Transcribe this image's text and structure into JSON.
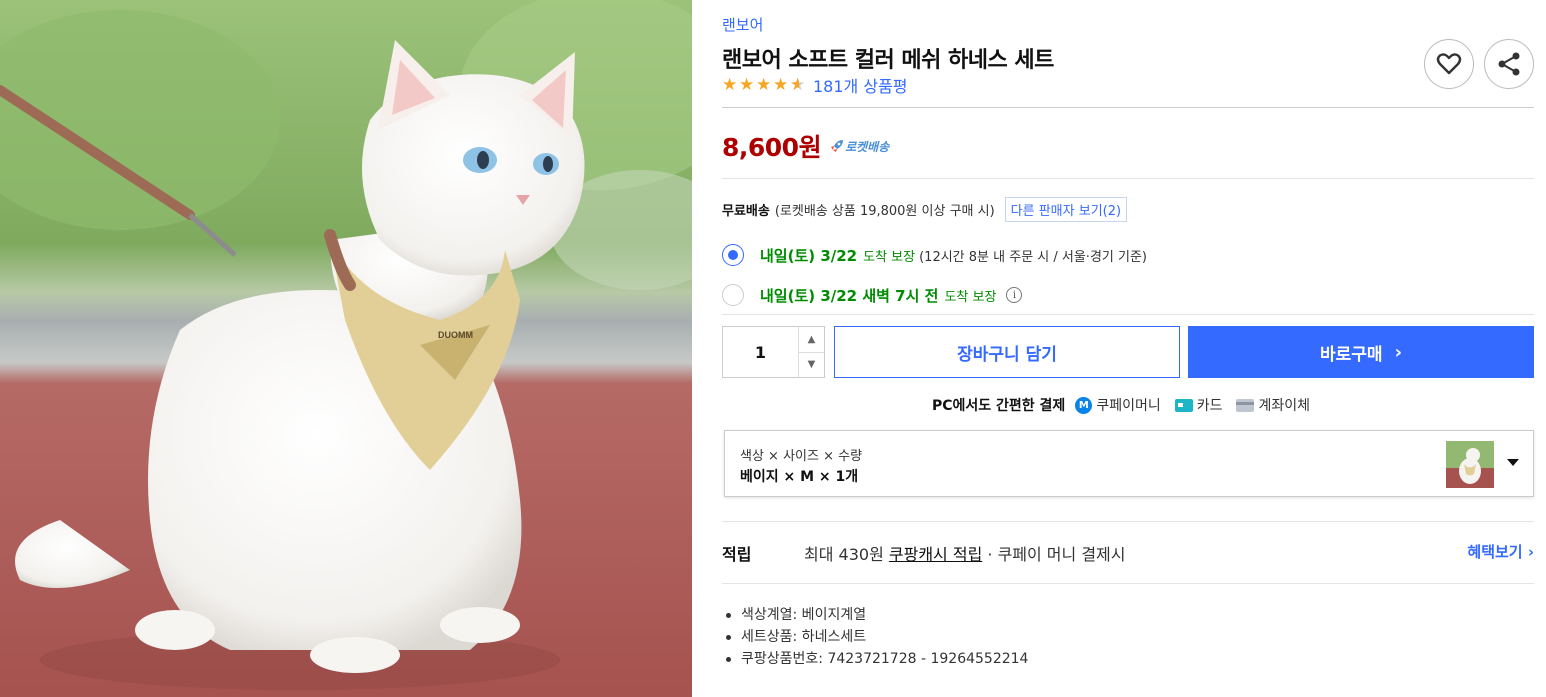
{
  "product": {
    "image_alt": "",
    "thumb_alt": "",
    "harness_brand_on_image": "DUOMM",
    "brand": "랜보어",
    "title": "랜보어 소프트 컬러 메쉬 하네스 세트",
    "rating": 4.5,
    "review_count": "181개 상품평",
    "price": "8,600원",
    "rocket_label": "로켓배송"
  },
  "shipping": {
    "free_label": "무료배송",
    "condition": "(로켓배송 상품 19,800원 이상 구매 시)",
    "other_sellers": "다른 판매자 보기(2)"
  },
  "delivery_options": [
    {
      "date": "내일(토) 3/22",
      "guarantee": "도착 보장",
      "note": "(12시간 8분 내 주문 시 / 서울·경기 기준)",
      "selected": true
    },
    {
      "date": "내일(토) 3/22 새벽 7시 전",
      "guarantee": "도착 보장",
      "note": "",
      "selected": false
    }
  ],
  "purchase": {
    "quantity": "1",
    "cart_label": "장바구니 담기",
    "buy_label": "바로구매",
    "buy_chevron": "›"
  },
  "payment": {
    "intro": "PC에서도 간편한 결제",
    "coupay_mark": "M",
    "methods": [
      "쿠페이머니",
      "카드",
      "계좌이체"
    ]
  },
  "option": {
    "label": "색상 × 사이즈 × 수량",
    "value": "베이지 × M × 1개"
  },
  "reward": {
    "title": "적립",
    "prefix": "최대 430원",
    "link": "쿠팡캐시 적립",
    "suffix": "· 쿠페이 머니 결제시",
    "benefit": "혜택보기 ›"
  },
  "attributes": [
    "색상계열: 베이지계열",
    "세트상품: 하네스세트",
    "쿠팡상품번호: 7423721728 - 19264552214"
  ],
  "colors": {
    "accent": "#346aff",
    "price": "#ae0000",
    "delivery": "#008c00",
    "star": "#f5a623"
  }
}
